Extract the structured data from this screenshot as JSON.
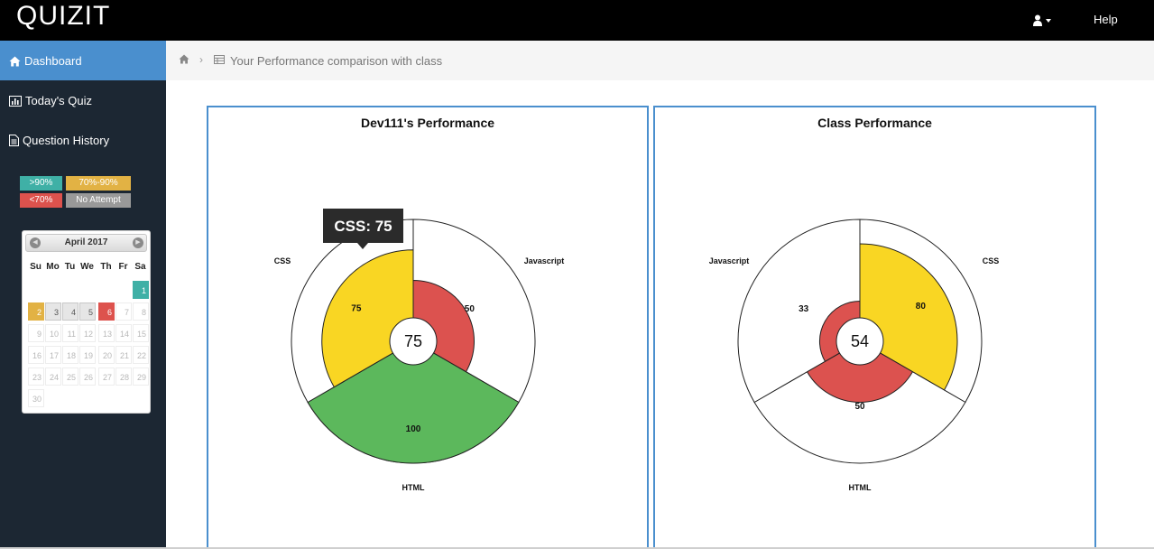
{
  "app": {
    "brand": "QUIZIT",
    "help_label": "Help"
  },
  "sidebar": {
    "items": [
      {
        "label": "Dashboard",
        "icon": "home-icon",
        "active": true
      },
      {
        "label": "Today's Quiz",
        "icon": "bar-chart-icon",
        "active": false
      },
      {
        "label": "Question History",
        "icon": "document-icon",
        "active": false
      }
    ],
    "legend": [
      {
        "label": ">90%",
        "color": "#3fb0a6"
      },
      {
        "label": "70%-90%",
        "color": "#e2b244"
      },
      {
        "label": "<70%",
        "color": "#dd524d"
      },
      {
        "label": "No Attempt",
        "color": "#999999"
      }
    ]
  },
  "calendar": {
    "title": "April 2017",
    "weekdays": [
      "Su",
      "Mo",
      "Tu",
      "We",
      "Th",
      "Fr",
      "Sa"
    ],
    "first_weekday": 6,
    "days_in_month": 30,
    "highlights": {
      "1": "teal",
      "2": "yellow",
      "3": "grey",
      "4": "grey",
      "5": "grey",
      "6": "red"
    }
  },
  "breadcrumb": {
    "text": "Your Performance comparison with class"
  },
  "chart_data": [
    {
      "type": "pie",
      "title": "Dev111's Performance",
      "categories": [
        "CSS",
        "Javascript",
        "HTML"
      ],
      "values": [
        75,
        50,
        100
      ],
      "colors": [
        "#f9d623",
        "#dc524f",
        "#5cb85c"
      ],
      "center_value": "75",
      "tooltip": "CSS: 75"
    },
    {
      "type": "pie",
      "title": "Class Performance",
      "categories": [
        "CSS",
        "Javascript",
        "HTML"
      ],
      "values": [
        80,
        33,
        50
      ],
      "colors": [
        "#f9d623",
        "#dc524f",
        "#dc524f"
      ],
      "center_value": "54"
    }
  ]
}
